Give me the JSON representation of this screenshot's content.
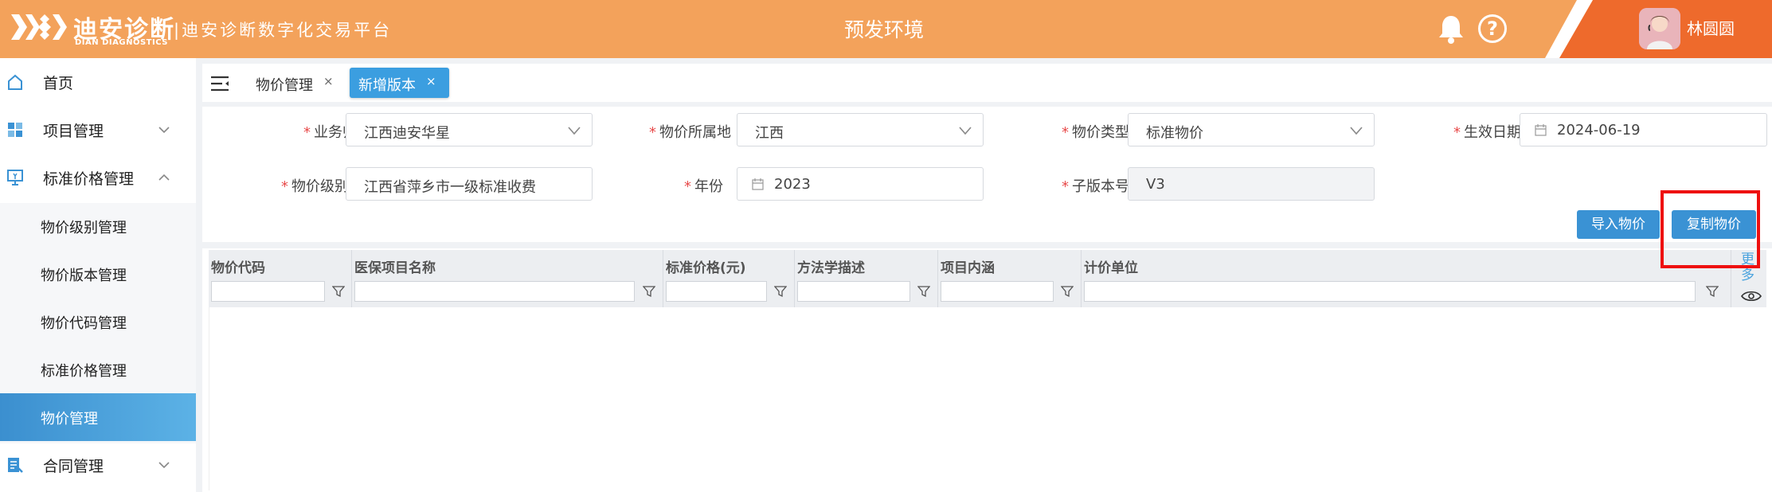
{
  "header": {
    "brand_cn": "迪安诊断",
    "brand_en": "DIAN DIAGNOSTICS",
    "platform": "|迪安诊断数字化交易平台",
    "environment": "预发环境",
    "username": "林圆圆",
    "icons": [
      "bell-icon",
      "help-icon",
      "avatar"
    ],
    "colors": {
      "header_bg": "#f3a25b",
      "corner_accent": "#ee6a2c"
    }
  },
  "sidebar": {
    "items": [
      {
        "label": "首页",
        "icon": "home-icon"
      },
      {
        "label": "项目管理",
        "icon": "grid-icon",
        "expanded": false
      },
      {
        "label": "标准价格管理",
        "icon": "monitor-icon",
        "expanded": true
      },
      {
        "label": "合同管理",
        "icon": "contract-icon",
        "expanded": false
      }
    ],
    "subitems": [
      {
        "label": "物价级别管理"
      },
      {
        "label": "物价版本管理"
      },
      {
        "label": "物价代码管理"
      },
      {
        "label": "标准价格管理"
      },
      {
        "label": "物价管理",
        "active": true
      }
    ],
    "colors": {
      "active_bg": "#3b8fcf"
    }
  },
  "tabs": [
    {
      "label": "物价管理",
      "close": "×",
      "active": false
    },
    {
      "label": "新增版本",
      "close": "×",
      "active": true
    }
  ],
  "form": {
    "business": {
      "label": "业务归属",
      "value": "江西迪安华星"
    },
    "region": {
      "label": "物价所属地",
      "value": "江西"
    },
    "price_type": {
      "label": "物价类型",
      "value": "标准物价"
    },
    "effective_date": {
      "label": "生效日期",
      "value": "2024-06-19"
    },
    "level_name": {
      "label": "物价级别名称",
      "value": "江西省萍乡市一级标准收费"
    },
    "year": {
      "label": "年份",
      "value": "2023"
    },
    "sub_version": {
      "label": "子版本号",
      "value": "V3"
    },
    "required_mark": "*"
  },
  "actions": {
    "import_label": "导入物价",
    "copy_label": "复制物价",
    "colors": {
      "button_bg": "#3a92d4",
      "highlight": "#ee0f0f"
    }
  },
  "grid": {
    "columns": [
      {
        "label": "物价代码"
      },
      {
        "label": "医保项目名称"
      },
      {
        "label": "标准价格(元)"
      },
      {
        "label": "方法学描述"
      },
      {
        "label": "项目内涵"
      },
      {
        "label": "计价单位"
      }
    ],
    "more_label": "更多",
    "rows": []
  }
}
